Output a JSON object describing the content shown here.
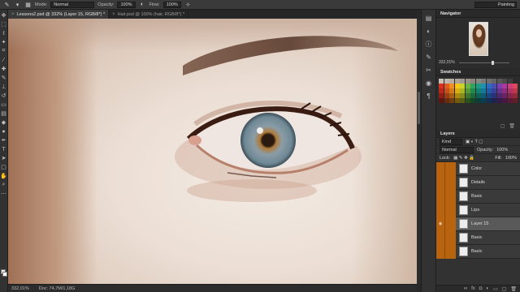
{
  "options": {
    "mode_label": "Mode:",
    "mode_value": "Normal",
    "opacity_label": "Opacity:",
    "opacity_value": "100%",
    "flow_label": "Flow:",
    "flow_value": "100%",
    "workspace": "Painting"
  },
  "tabs": [
    {
      "label": "Lessons2.psd @ 332% (Layer 15, RGB/8*) *",
      "close": "×"
    },
    {
      "label": "Hair.psd @ 100% (hair, RGB/8*) *",
      "close": "×"
    }
  ],
  "status": {
    "zoom": "332,01%",
    "doc": "Doc: 74,7M/1,18G"
  },
  "navigator": {
    "title": "Navigator",
    "zoom": "332,01%"
  },
  "swatches": {
    "title": "Swatches",
    "colors": [
      "#c9c0b8",
      "#bfb6ae",
      "#b5aca4",
      "#aba29a",
      "#a19890",
      "#978e86",
      "#8d847c",
      "#838a82",
      "#7a7a78",
      "#6f6f6f",
      "#646464",
      "#585858",
      "#4b4b4b",
      "#3d3d3d",
      "#2a2a2a",
      "#d9301f",
      "#e35b1e",
      "#f28e1c",
      "#f5c518",
      "#c9d32a",
      "#6ab340",
      "#2da35c",
      "#1e9a86",
      "#1f8fb2",
      "#2a6dc0",
      "#4a4fb5",
      "#7c3fb0",
      "#a83b9d",
      "#d03d7d",
      "#e1465a",
      "#b8281d",
      "#c8501b",
      "#d67a18",
      "#d9ad16",
      "#abb524",
      "#539a36",
      "#22894e",
      "#177f70",
      "#177797",
      "#205aa3",
      "#3a3f99",
      "#66338f",
      "#8c2f82",
      "#b03168",
      "#be3849",
      "#8e1f16",
      "#9c3d14",
      "#a85f12",
      "#ad8811",
      "#848d1c",
      "#3f772a",
      "#1a6a3c",
      "#115f55",
      "#115a74",
      "#18457d",
      "#2c3076",
      "#4d276c",
      "#6b2362",
      "#87254f",
      "#922a38",
      "#5e140f",
      "#6a2a0d",
      "#733f0c",
      "#755c0b",
      "#5a6014",
      "#2b511d",
      "#114829",
      "#0b403a",
      "#0b3d4f",
      "#103056",
      "#1e2151",
      "#351a4a",
      "#491842",
      "#5c1936",
      "#631c26"
    ]
  },
  "layers": {
    "title": "Layers",
    "kind_label": "Kind",
    "blend_mode": "Normal",
    "opacity_label": "Opacity:",
    "opacity_value": "100%",
    "lock_label": "Lock:",
    "fill_label": "Fill:",
    "fill_value": "100%",
    "items": [
      {
        "name": "Color",
        "active": false,
        "visible": false
      },
      {
        "name": "Details",
        "active": false,
        "visible": false
      },
      {
        "name": "Basic",
        "active": false,
        "visible": false
      },
      {
        "name": "Lips",
        "active": false,
        "visible": false
      },
      {
        "name": "Layer 15",
        "active": true,
        "visible": true
      },
      {
        "name": "Basic",
        "active": false,
        "visible": false
      },
      {
        "name": "Basic",
        "active": false,
        "visible": false
      }
    ]
  }
}
